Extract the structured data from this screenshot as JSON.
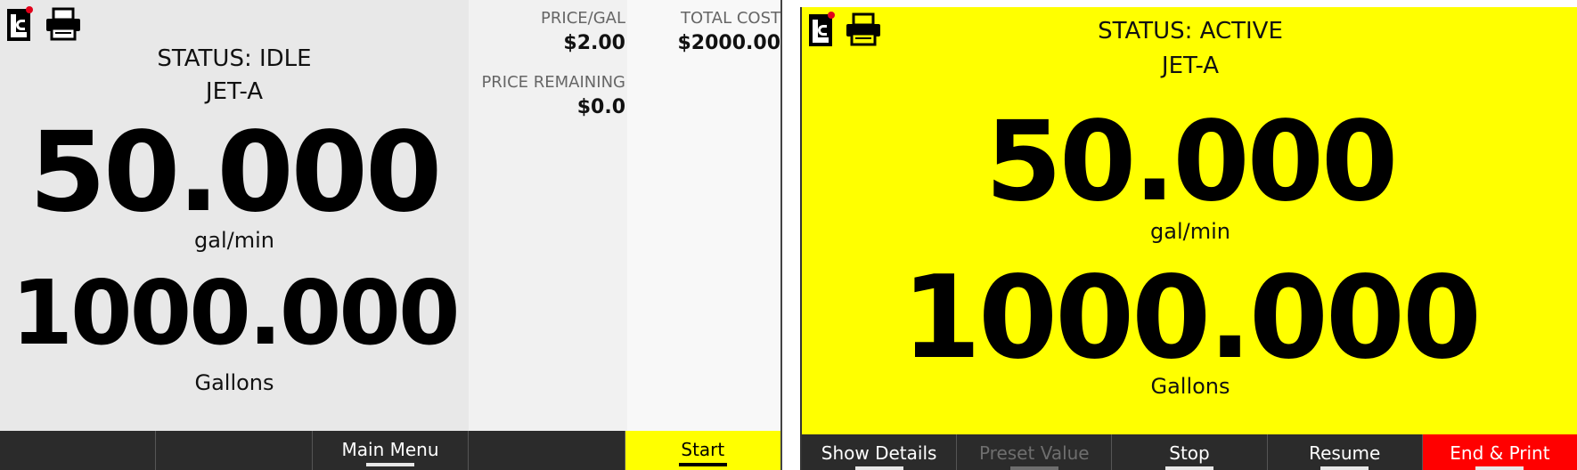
{
  "left_screen": {
    "status": "STATUS: IDLE",
    "fuel": "JET-A",
    "rate_value": "50.000",
    "rate_unit": "gal/min",
    "volume_value": "1000.000",
    "volume_unit": "Gallons",
    "price_per_gal_label": "PRICE/GAL",
    "price_per_gal_value": "$2.00",
    "total_cost_label": "TOTAL COST",
    "total_cost_value": "$2000.00",
    "price_remaining_label": "PRICE REMAINING",
    "price_remaining_value": "$0.0",
    "bottom_buttons": [
      "",
      "",
      "Main Menu",
      "",
      "Start"
    ]
  },
  "right_screen": {
    "status": "STATUS: ACTIVE",
    "fuel": "JET-A",
    "rate_value": "50.000",
    "rate_unit": "gal/min",
    "volume_value": "1000.000",
    "volume_unit": "Gallons",
    "bottom_buttons": [
      "Show Details",
      "Preset Value",
      "Stop",
      "Resume",
      "End & Print"
    ]
  },
  "colors": {
    "active_yellow": "#ffff00",
    "end_print_red": "#ff0000",
    "bar_dark": "#2b2b2b"
  },
  "icons": [
    "logo-icon",
    "printer-icon"
  ]
}
